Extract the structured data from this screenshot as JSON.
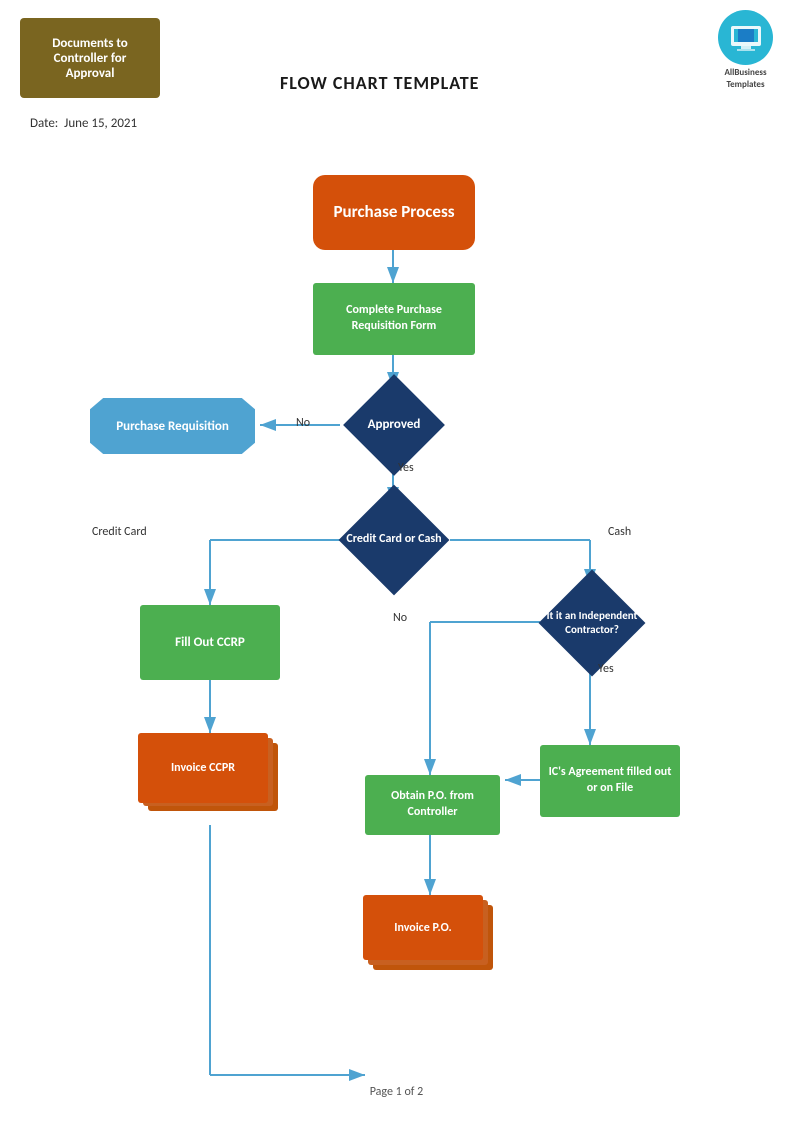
{
  "header": {
    "docs_box_label": "Documents to Controller for Approval",
    "page_title": "FLOW CHART TEMPLATE",
    "logo_text": "AllBusiness\nTemplates",
    "date_label": "Date:",
    "date_value": "June 15, 2021"
  },
  "flowchart": {
    "nodes": {
      "purchase_process": "Purchase Process",
      "complete_form": "Complete Purchase Requisition Form",
      "approved": "Approved",
      "purchase_requisition": "Purchase Requisition",
      "credit_card_cash": "Credit Card or Cash",
      "fill_ccrp": "Fill Out CCRP",
      "invoice_ccpr": "Invoice CCPR",
      "independent_contractor": "It it an Independent Contractor?",
      "ic_agreement": "IC's Agreement filled out or on File",
      "obtain_po": "Obtain P.O. from Controller",
      "invoice_po": "Invoice P.O."
    },
    "labels": {
      "no": "No",
      "yes": "Yes",
      "credit_card": "Credit Card",
      "cash": "Cash"
    }
  },
  "footer": {
    "page": "Page 1 of 2"
  },
  "colors": {
    "orange": "#d4500a",
    "green": "#4caf50",
    "dark_navy": "#1a3a6b",
    "blue_ribbon": "#4fa3d1",
    "olive": "#7a6520",
    "teal_logo": "#29b6d4"
  }
}
